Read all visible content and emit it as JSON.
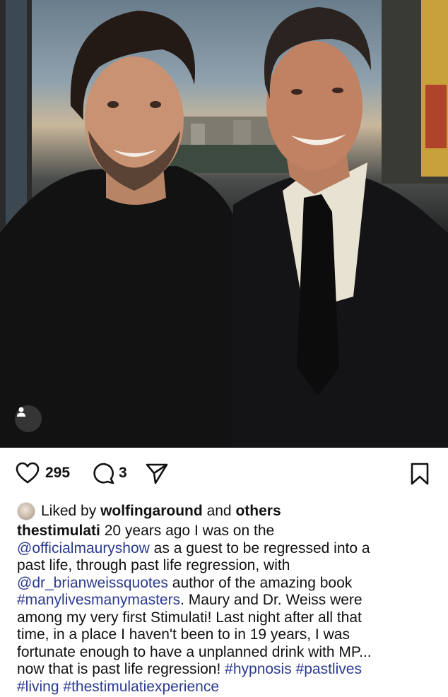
{
  "post": {
    "likes_count": "295",
    "comments_count": "3",
    "liked_by": {
      "prefix": "Liked by",
      "user": "wolfingaround",
      "conj": "and",
      "others": "others"
    },
    "caption": {
      "username": "thestimulati",
      "lines": [
        [
          {
            "t": "username"
          },
          {
            "t": "text",
            "v": " 20 years ago I was on the"
          }
        ],
        [
          {
            "t": "link",
            "v": "@officialmauryshow"
          },
          {
            "t": "text",
            "v": " as a guest to be regressed into a"
          }
        ],
        [
          {
            "t": "text",
            "v": "past life, through past life regression, with"
          }
        ],
        [
          {
            "t": "link",
            "v": "@dr_brianweissquotes"
          },
          {
            "t": "text",
            "v": " author of the amazing book"
          }
        ],
        [
          {
            "t": "link",
            "v": "#manylivesmanymasters"
          },
          {
            "t": "text",
            "v": ". Maury and Dr. Weiss were"
          }
        ],
        [
          {
            "t": "text",
            "v": "among my very first Stimulati! Last night after all that"
          }
        ],
        [
          {
            "t": "text",
            "v": "time, in a place I haven't been to in 19 years, I was"
          }
        ],
        [
          {
            "t": "text",
            "v": "fortunate enough to have a unplanned drink with MP..."
          }
        ],
        [
          {
            "t": "text",
            "v": "now that is past life regression! "
          },
          {
            "t": "link",
            "v": "#hypnosis"
          },
          {
            "t": "text",
            "v": " "
          },
          {
            "t": "link",
            "v": "#pastlives"
          }
        ],
        [
          {
            "t": "link",
            "v": "#living"
          },
          {
            "t": "text",
            "v": " "
          },
          {
            "t": "link",
            "v": "#thestimulatiexperience"
          }
        ]
      ]
    }
  },
  "icons": {
    "like": "heart-icon",
    "comment": "comment-icon",
    "share": "send-icon",
    "save": "bookmark-icon",
    "tag": "person-tag-icon"
  },
  "colors": {
    "link": "#2b3a8f",
    "text": "#111111"
  }
}
